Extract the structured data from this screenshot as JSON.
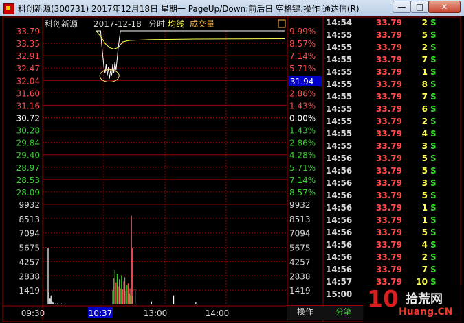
{
  "window": {
    "title": "科创新源(300731) 2017年12月18日 星期一 PageUp/Down:前后日 空格键:操作 通达信(R)",
    "minimize_label": "—",
    "maximize_label": "□",
    "close_label": "✕"
  },
  "chart_header": {
    "stock_name": "科创新源",
    "date": "2017-12-18",
    "mode": "分时",
    "avg_label": "均线",
    "volume_label": "成交量",
    "toggle_icon": "restore-icon"
  },
  "price_axis": {
    "left_labels": [
      "33.79",
      "33.35",
      "32.91",
      "32.47",
      "32.04",
      "31.60",
      "31.16",
      "30.72",
      "30.28",
      "29.84",
      "29.40",
      "28.97",
      "28.53",
      "28.09"
    ],
    "right_labels": [
      "9.99%",
      "8.57%",
      "7.14%",
      "5.71%",
      "4.28%",
      "2.86%",
      "1.43%",
      "0.00%",
      "1.43%",
      "2.86%",
      "4.28%",
      "5.71%",
      "7.14%",
      "8.57%"
    ],
    "cursor_value": "31.94"
  },
  "volume_axis": {
    "labels": [
      "9932",
      "8513",
      "7094",
      "5675",
      "4257",
      "2838",
      "1419"
    ]
  },
  "time_axis": {
    "labels": [
      "09:30",
      "10:37",
      "13:00",
      "14:00"
    ]
  },
  "chart_data": {
    "type": "line",
    "prev_close": 30.72,
    "high_limit": 33.79,
    "price_ylim": [
      28.09,
      33.79
    ],
    "volume_ylim": [
      0,
      9932
    ],
    "price_series": [
      {
        "t": 0,
        "v": 33.79
      },
      {
        "t": 4,
        "v": 33.79
      },
      {
        "t": 5,
        "v": 33.3
      },
      {
        "t": 6,
        "v": 32.9
      },
      {
        "t": 7,
        "v": 32.5
      },
      {
        "t": 8,
        "v": 32.3
      },
      {
        "t": 9,
        "v": 32.6
      },
      {
        "t": 10,
        "v": 32.2
      },
      {
        "t": 11,
        "v": 32.5
      },
      {
        "t": 12,
        "v": 32.1
      },
      {
        "t": 13,
        "v": 32.4
      },
      {
        "t": 14,
        "v": 32.2
      },
      {
        "t": 15,
        "v": 32.6
      },
      {
        "t": 16,
        "v": 32.3
      },
      {
        "t": 17,
        "v": 32.7
      },
      {
        "t": 18,
        "v": 32.4
      },
      {
        "t": 19,
        "v": 32.8
      },
      {
        "t": 20,
        "v": 33.2
      },
      {
        "t": 21,
        "v": 33.5
      },
      {
        "t": 22,
        "v": 33.79
      },
      {
        "t": 240,
        "v": 33.79
      }
    ],
    "avg_series": [
      {
        "t": 0,
        "v": 33.79
      },
      {
        "t": 4,
        "v": 33.6
      },
      {
        "t": 8,
        "v": 33.35
      },
      {
        "t": 12,
        "v": 33.2
      },
      {
        "t": 16,
        "v": 33.15
      },
      {
        "t": 20,
        "v": 33.2
      },
      {
        "t": 24,
        "v": 33.4
      },
      {
        "t": 30,
        "v": 33.45
      },
      {
        "t": 60,
        "v": 33.48
      },
      {
        "t": 120,
        "v": 33.5
      },
      {
        "t": 240,
        "v": 33.51
      }
    ],
    "volume_bars": [
      {
        "t": 0,
        "v": 5600,
        "c": "w"
      },
      {
        "t": 1,
        "v": 1200,
        "c": "w"
      },
      {
        "t": 2,
        "v": 600,
        "c": "w"
      },
      {
        "t": 3,
        "v": 900,
        "c": "w"
      },
      {
        "t": 4,
        "v": 300,
        "c": "w"
      },
      {
        "t": 5,
        "v": 200,
        "c": "w"
      },
      {
        "t": 6,
        "v": 150,
        "c": "w"
      },
      {
        "t": 8,
        "v": 120,
        "c": "w"
      },
      {
        "t": 10,
        "v": 100,
        "c": "w"
      },
      {
        "t": 14,
        "v": 90,
        "c": "w"
      },
      {
        "t": 55,
        "v": 1400,
        "c": "g"
      },
      {
        "t": 56,
        "v": 2600,
        "c": "r"
      },
      {
        "t": 57,
        "v": 3400,
        "c": "g"
      },
      {
        "t": 58,
        "v": 2200,
        "c": "r"
      },
      {
        "t": 59,
        "v": 3000,
        "c": "g"
      },
      {
        "t": 60,
        "v": 1800,
        "c": "r"
      },
      {
        "t": 61,
        "v": 2500,
        "c": "g"
      },
      {
        "t": 62,
        "v": 1600,
        "c": "r"
      },
      {
        "t": 63,
        "v": 2900,
        "c": "g"
      },
      {
        "t": 64,
        "v": 1500,
        "c": "r"
      },
      {
        "t": 65,
        "v": 2300,
        "c": "r"
      },
      {
        "t": 66,
        "v": 2700,
        "c": "g"
      },
      {
        "t": 67,
        "v": 1300,
        "c": "r"
      },
      {
        "t": 68,
        "v": 1900,
        "c": "g"
      },
      {
        "t": 69,
        "v": 2100,
        "c": "r"
      },
      {
        "t": 70,
        "v": 1100,
        "c": "g"
      },
      {
        "t": 71,
        "v": 1600,
        "c": "r"
      },
      {
        "t": 72,
        "v": 900,
        "c": "g"
      },
      {
        "t": 73,
        "v": 8800,
        "c": "r"
      },
      {
        "t": 74,
        "v": 5600,
        "c": "r"
      },
      {
        "t": 75,
        "v": 900,
        "c": "w"
      },
      {
        "t": 78,
        "v": 1500,
        "c": "w"
      },
      {
        "t": 100,
        "v": 300,
        "c": "w"
      },
      {
        "t": 130,
        "v": 900,
        "c": "w"
      },
      {
        "t": 160,
        "v": 200,
        "c": "w"
      }
    ]
  },
  "trades": [
    {
      "time": "14:54",
      "price": "33.79",
      "vol": "2",
      "side": "S"
    },
    {
      "time": "14:55",
      "price": "33.79",
      "vol": "5",
      "side": "S"
    },
    {
      "time": "14:55",
      "price": "33.79",
      "vol": "2",
      "side": "S"
    },
    {
      "time": "14:55",
      "price": "33.79",
      "vol": "7",
      "side": "S"
    },
    {
      "time": "14:55",
      "price": "33.79",
      "vol": "1",
      "side": "S"
    },
    {
      "time": "14:55",
      "price": "33.79",
      "vol": "8",
      "side": "S"
    },
    {
      "time": "14:55",
      "price": "33.79",
      "vol": "7",
      "side": "S"
    },
    {
      "time": "14:55",
      "price": "33.79",
      "vol": "6",
      "side": "S"
    },
    {
      "time": "14:55",
      "price": "33.79",
      "vol": "2",
      "side": "S"
    },
    {
      "time": "14:55",
      "price": "33.79",
      "vol": "4",
      "side": "S"
    },
    {
      "time": "14:55",
      "price": "33.79",
      "vol": "3",
      "side": "S"
    },
    {
      "time": "14:56",
      "price": "33.79",
      "vol": "5",
      "side": "S"
    },
    {
      "time": "14:56",
      "price": "33.79",
      "vol": "5",
      "side": "S"
    },
    {
      "time": "14:56",
      "price": "33.79",
      "vol": "3",
      "side": "S"
    },
    {
      "time": "14:56",
      "price": "33.79",
      "vol": "5",
      "side": "S"
    },
    {
      "time": "14:56",
      "price": "33.79",
      "vol": "1",
      "side": "S"
    },
    {
      "time": "14:56",
      "price": "33.79",
      "vol": "1",
      "side": "S"
    },
    {
      "time": "14:56",
      "price": "33.79",
      "vol": "5",
      "side": "S"
    },
    {
      "time": "14:56",
      "price": "33.79",
      "vol": "4",
      "side": "S"
    },
    {
      "time": "14:56",
      "price": "33.79",
      "vol": "2",
      "side": "S"
    },
    {
      "time": "14:56",
      "price": "33.79",
      "vol": "7",
      "side": "S"
    },
    {
      "time": "14:57",
      "price": "33.79",
      "vol": "10",
      "side": "S"
    },
    {
      "time": "15:00",
      "price": "",
      "vol": "",
      "side": ""
    }
  ],
  "tabs": {
    "ops_label": "操作",
    "trades_label": "分笔"
  },
  "watermark": {
    "big": "10",
    "cn": "拾荒网",
    "url": "Huang.CN"
  },
  "colors": {
    "grid": "#9e0000",
    "price_line": "#ffffff",
    "avg_line": "#ffff54",
    "up": "#ff4b4b",
    "down": "#39d22f"
  }
}
